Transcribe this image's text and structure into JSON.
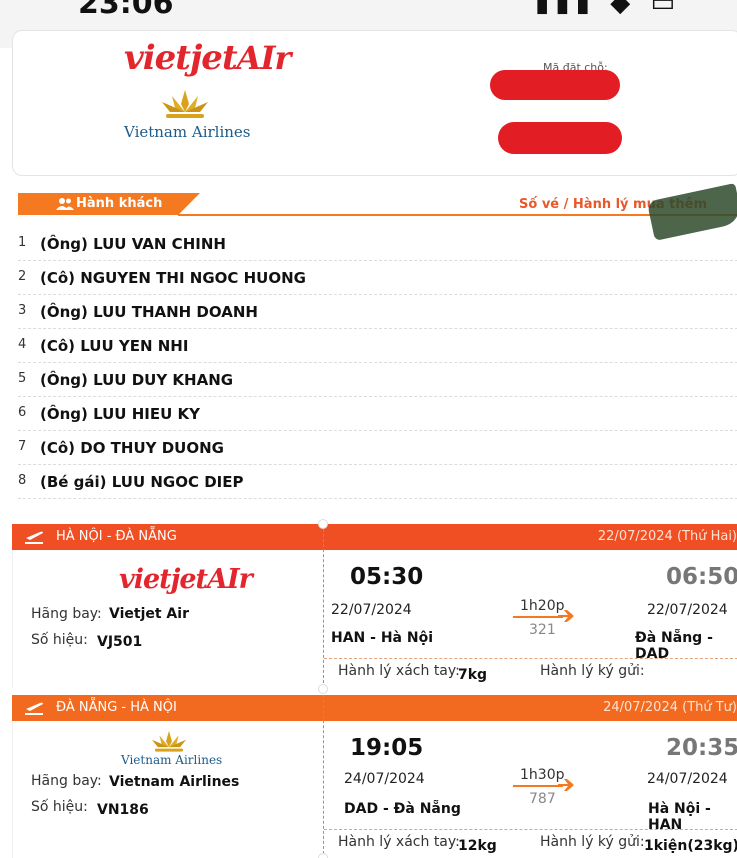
{
  "status_bar": {
    "time": "23:06",
    "icons": "▮▮▮ ◆ ▭"
  },
  "logos": {
    "vietjet": "vietjet",
    "vietjet_air": "AIr",
    "vietnam_airlines": "Vietnam Airlines"
  },
  "booking": {
    "code_label": "Mã đặt chỗ:"
  },
  "passengers_section": {
    "title": "Hành khách",
    "right_label": "Số vé / Hành lý mua thêm",
    "list": [
      {
        "no": "1",
        "name": "(Ông)  LUU VAN CHINH"
      },
      {
        "no": "2",
        "name": "(Cô)  NGUYEN THI NGOC HUONG"
      },
      {
        "no": "3",
        "name": "(Ông)  LUU THANH DOANH"
      },
      {
        "no": "4",
        "name": "(Cô)  LUU YEN NHI"
      },
      {
        "no": "5",
        "name": "(Ông)  LUU DUY KHANG"
      },
      {
        "no": "6",
        "name": "(Ông)  LUU HIEU KY"
      },
      {
        "no": "7",
        "name": "(Cô)  DO THUY DUONG"
      },
      {
        "no": "8",
        "name": "(Bé gái)  LUU NGOC DIEP"
      }
    ]
  },
  "flights": [
    {
      "route": "HÀ NỘI - ĐÀ NẴNG",
      "date_header": "22/07/2024 (Thứ Hai)",
      "airline_label": "Hãng bay:",
      "airline": "Vietjet Air",
      "flight_no_label": "Số hiệu:",
      "flight_no": "VJ501",
      "depart_time": "05:30",
      "arrive_time": "06:50",
      "depart_date": "22/07/2024",
      "arrive_date": "22/07/2024",
      "depart_place": "HAN - Hà Nội",
      "arrive_place": "Đà Nẵng - DAD",
      "duration": "1h20p",
      "aircraft": "321",
      "carry_on_label": "Hành lý xách tay:",
      "carry_on": "7kg",
      "checked_label": "Hành lý ký gửi:",
      "checked": ""
    },
    {
      "route": "ĐÀ NẴNG - HÀ NỘI",
      "date_header": "24/07/2024 (Thứ Tư)",
      "airline_label": "Hãng bay:",
      "airline": "Vietnam Airlines",
      "flight_no_label": "Số hiệu:",
      "flight_no": "VN186",
      "depart_time": "19:05",
      "arrive_time": "20:35",
      "depart_date": "24/07/2024",
      "arrive_date": "24/07/2024",
      "depart_place": "DAD - Đà Nẵng",
      "arrive_place": "Hà Nội - HAN",
      "duration": "1h30p",
      "aircraft": "787",
      "carry_on_label": "Hành lý xách tay:",
      "carry_on": "12kg",
      "checked_label": "Hành lý ký gửi:",
      "checked": "1kiện(23kg)"
    }
  ],
  "colors": {
    "brand_orange": "#f47920",
    "header_red": "#f04e23",
    "vietjet_red": "#e3262d",
    "vna_blue": "#1c5b8c"
  }
}
